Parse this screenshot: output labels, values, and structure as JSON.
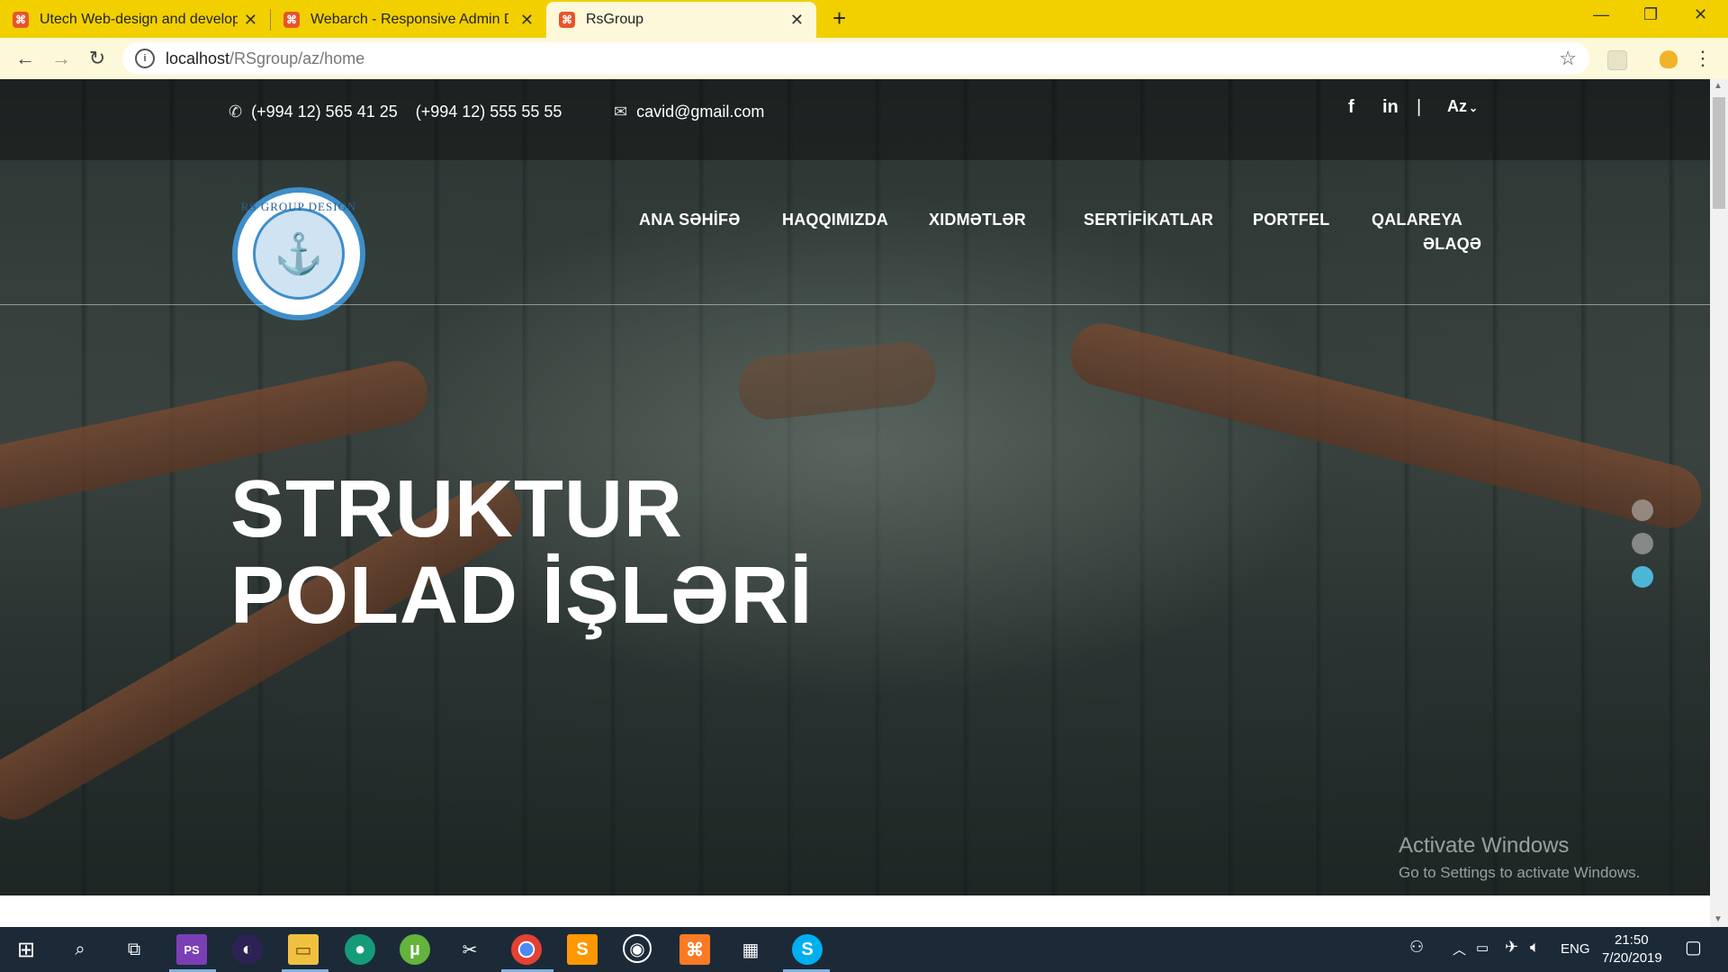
{
  "browser": {
    "tabs": [
      {
        "title": "Utech Web-design and developin",
        "active": false
      },
      {
        "title": "Webarch - Responsive Admin Da",
        "active": false
      },
      {
        "title": "RsGroup",
        "active": true
      }
    ],
    "url_host": "localhost",
    "url_path": "/RSgroup/az/home"
  },
  "site": {
    "contact": {
      "phone1": "(+994 12) 565 41 25",
      "phone2": "(+994 12) 555 55 55",
      "email": "cavid@gmail.com"
    },
    "social": {
      "facebook": "f",
      "linkedin": "in",
      "separator": "|",
      "language": "Az"
    },
    "logo_text": "RS GROUP DESIGN",
    "nav": [
      "ANA SƏHİFƏ",
      "HAQQIMIZDA",
      "XIDMƏTLƏR",
      "SERTİFİKATLAR",
      "PORTFEL",
      "QALAREYA",
      "ƏLAQƏ"
    ],
    "headline_line1": "STRUKTUR",
    "headline_line2": "POLAD İŞLƏRİ",
    "slider_dots": 3,
    "slider_active": 3
  },
  "watermark": {
    "title": "Activate Windows",
    "subtitle": "Go to Settings to activate Windows."
  },
  "taskbar": {
    "language": "ENG",
    "time": "21:50",
    "date": "7/20/2019"
  }
}
